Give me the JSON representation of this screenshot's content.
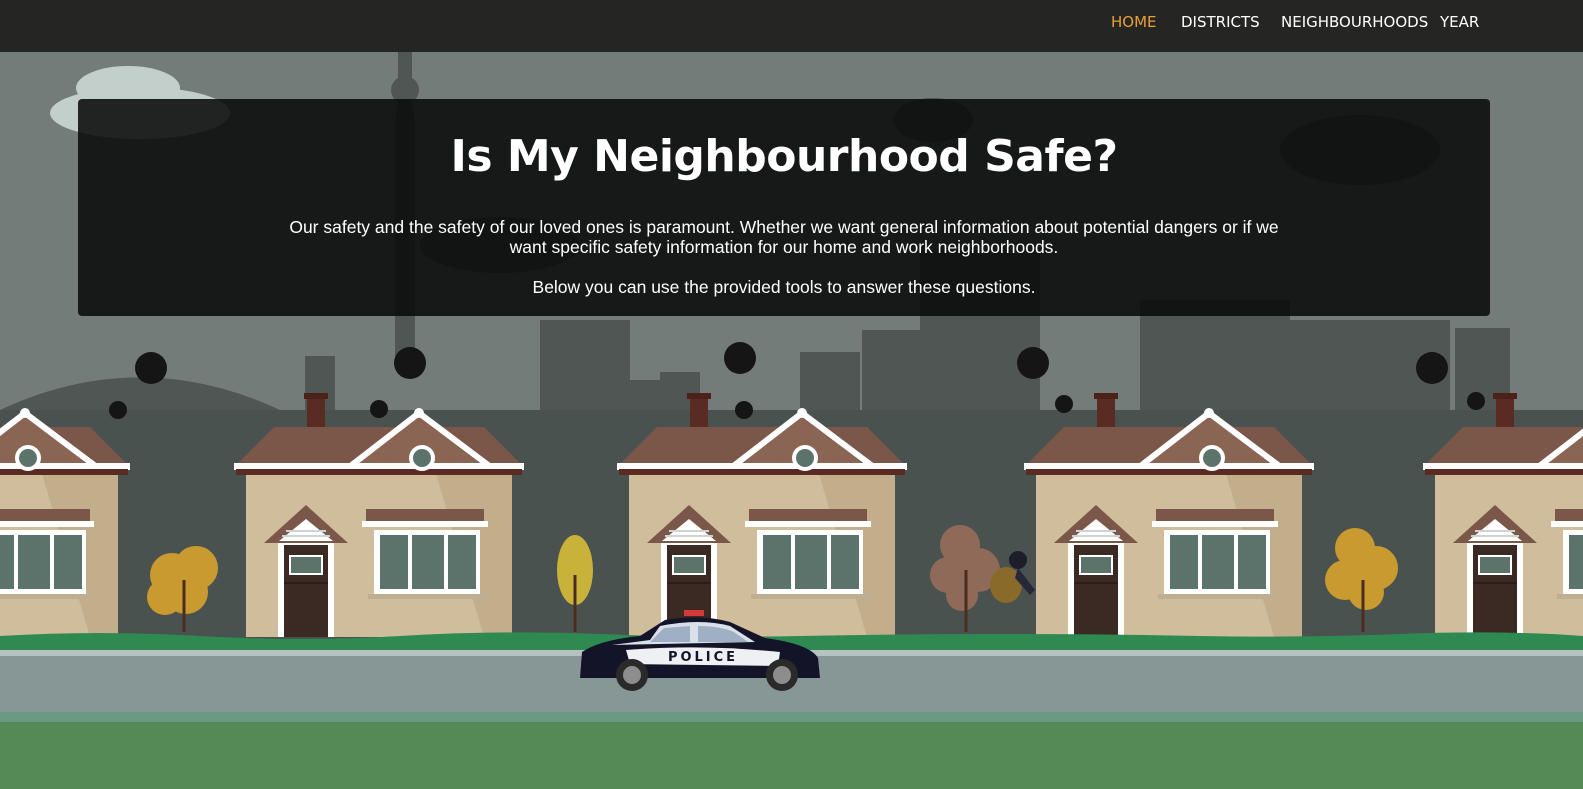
{
  "nav": {
    "items": [
      {
        "label": "HOME",
        "active": true
      },
      {
        "label": "DISTRICTS",
        "active": false
      },
      {
        "label": "NEIGHBOURHOODS",
        "active": false
      },
      {
        "label": "YEAR",
        "active": false
      }
    ],
    "active_color": "#e8a03a"
  },
  "hero": {
    "title": "Is My Neighbourhood Safe?",
    "paragraph_1": "Our safety and the safety of our loved ones is paramount. Whether we want general information about potential dangers or if we want specific safety information for our home and work neighborhoods.",
    "paragraph_2": "Below you can use the provided tools to answer these questions."
  },
  "illustration": {
    "police_car_text": "POLICE",
    "colors": {
      "sky": "#747c79",
      "skyline": "#4f5653",
      "grass": "#2f8a52",
      "road": "#879795",
      "lawn": "#548a56",
      "house_wall": "#d0bd9c",
      "roof": "#7a5748"
    }
  }
}
